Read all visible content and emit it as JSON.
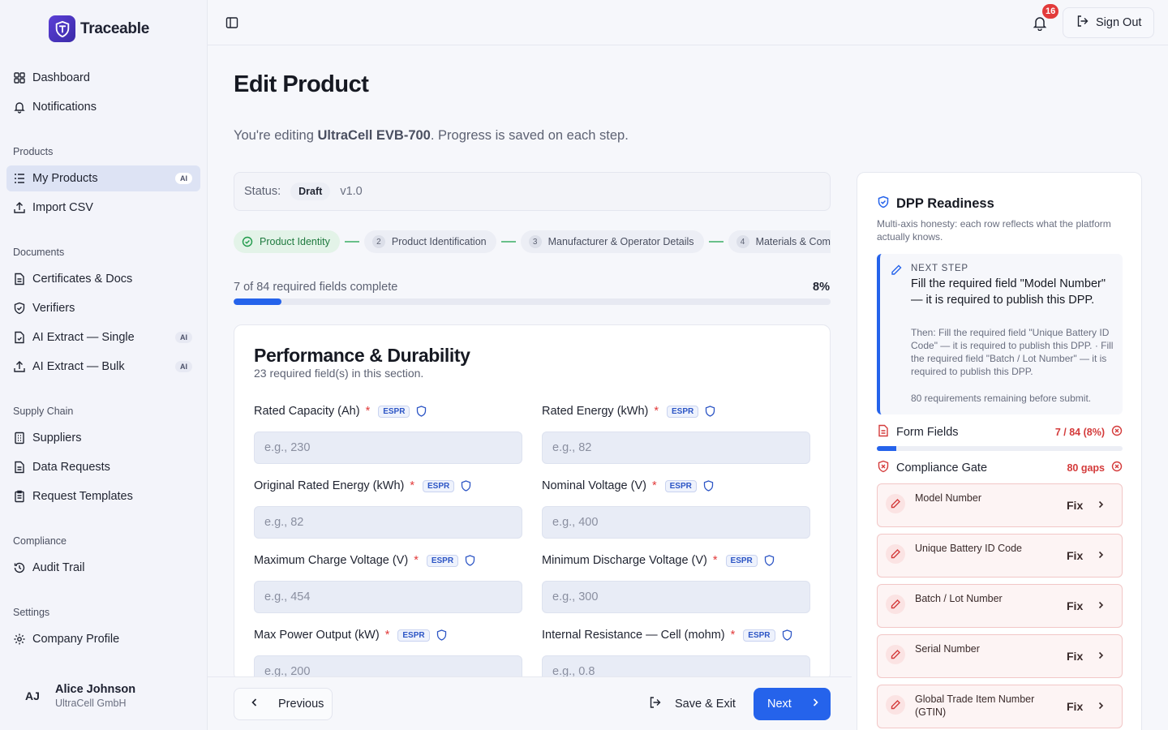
{
  "app": {
    "name": "Traceable"
  },
  "sidebar": {
    "top_items": [
      {
        "label": "Dashboard",
        "icon": "grid-icon"
      },
      {
        "label": "Notifications",
        "icon": "bell-icon"
      }
    ],
    "sections": [
      {
        "label": "Products",
        "items": [
          {
            "label": "My Products",
            "icon": "list-icon",
            "badge": "AI",
            "active": true
          },
          {
            "label": "Import CSV",
            "icon": "upload-icon"
          }
        ]
      },
      {
        "label": "Documents",
        "items": [
          {
            "label": "Certificates & Docs",
            "icon": "document-icon"
          },
          {
            "label": "Verifiers",
            "icon": "shield-icon"
          },
          {
            "label": "AI Extract — Single",
            "icon": "file-scan-icon",
            "badge": "AI"
          },
          {
            "label": "AI Extract — Bulk",
            "icon": "upload-icon",
            "badge": "AI"
          }
        ]
      },
      {
        "label": "Supply Chain",
        "items": [
          {
            "label": "Suppliers",
            "icon": "building-icon"
          },
          {
            "label": "Data Requests",
            "icon": "document-icon"
          },
          {
            "label": "Request Templates",
            "icon": "clipboard-icon"
          }
        ]
      },
      {
        "label": "Compliance",
        "items": [
          {
            "label": "Audit Trail",
            "icon": "history-icon"
          }
        ]
      },
      {
        "label": "Settings",
        "items": [
          {
            "label": "Company Profile",
            "icon": "gear-icon"
          }
        ]
      }
    ],
    "user": {
      "initials": "AJ",
      "name": "Alice Johnson",
      "org": "UltraCell GmbH"
    }
  },
  "topbar": {
    "notification_count": "16",
    "sign_out_label": "Sign Out"
  },
  "page": {
    "title": "Edit Product",
    "subtitle_prefix": "You're editing ",
    "product_name": "UltraCell EVB-700",
    "subtitle_suffix": ". Progress is saved on each step.",
    "status_label": "Status:",
    "status_value": "Draft",
    "version": "v1.0"
  },
  "steps": [
    {
      "label": "Product Identity",
      "state": "done"
    },
    {
      "num": "2",
      "label": "Product Identification"
    },
    {
      "num": "3",
      "label": "Manufacturer & Operator Details"
    },
    {
      "num": "4",
      "label": "Materials & Composition"
    }
  ],
  "progress": {
    "label": "7 of 84 required fields complete",
    "percent_label": "8%",
    "fraction": 0.08
  },
  "form_section": {
    "title": "Performance & Durability",
    "subtitle": "23 required field(s) in this section.",
    "tag": "ESPR",
    "required_marker": "*",
    "fields": [
      {
        "label": "Rated Capacity (Ah)",
        "placeholder": "e.g., 230"
      },
      {
        "label": "Rated Energy (kWh)",
        "placeholder": "e.g., 82"
      },
      {
        "label": "Original Rated Energy (kWh)",
        "placeholder": "e.g., 82"
      },
      {
        "label": "Nominal Voltage (V)",
        "placeholder": "e.g., 400"
      },
      {
        "label": "Maximum Charge Voltage (V)",
        "placeholder": "e.g., 454"
      },
      {
        "label": "Minimum Discharge Voltage (V)",
        "placeholder": "e.g., 300"
      },
      {
        "label": "Max Power Output (kW)",
        "placeholder": "e.g., 200"
      },
      {
        "label": "Internal Resistance — Cell (mohm)",
        "placeholder": "e.g., 0.8"
      }
    ]
  },
  "footer": {
    "previous_label": "Previous",
    "save_exit_label": "Save & Exit",
    "next_label": "Next"
  },
  "readiness": {
    "title": "DPP Readiness",
    "description": "Multi-axis honesty: each row reflects what the platform actually knows.",
    "next_step": {
      "label": "NEXT STEP",
      "main": "Fill the required field \"Model Number\" — it is required to publish this DPP.",
      "then": "Then: Fill the required field \"Unique Battery ID Code\" — it is required to publish this DPP. · Fill the required field \"Batch / Lot Number\" — it is required to publish this DPP.",
      "remaining": "80 requirements remaining before submit."
    },
    "form_fields": {
      "label": "Form Fields",
      "value": "7 / 84 (8%)",
      "fraction": 0.08
    },
    "compliance_gate": {
      "label": "Compliance Gate",
      "value": "80 gaps"
    },
    "fix_label": "Fix",
    "gaps": [
      {
        "name": "Model Number"
      },
      {
        "name": "Unique Battery ID Code"
      },
      {
        "name": "Batch / Lot Number"
      },
      {
        "name": "Serial Number"
      },
      {
        "name": "Global Trade Item Number (GTIN)"
      }
    ]
  },
  "colors": {
    "primary": "#2563eb",
    "brand": "#4b33c2",
    "danger": "#e23a3a",
    "success": "#1f7a3f"
  }
}
